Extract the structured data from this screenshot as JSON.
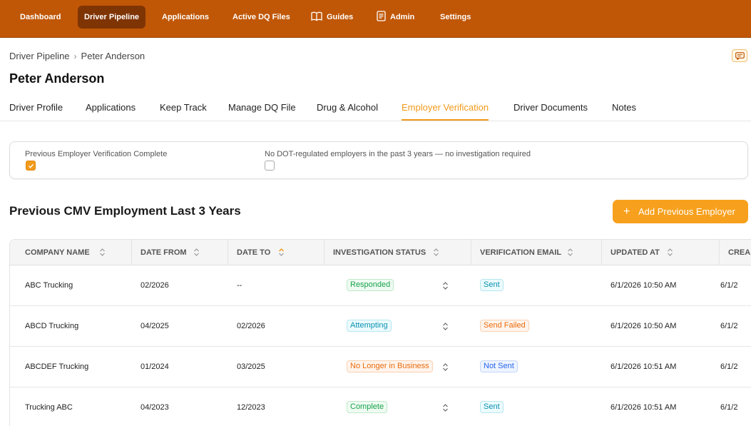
{
  "nav": {
    "items": [
      "Dashboard",
      "Driver Pipeline",
      "Applications",
      "Active DQ Files",
      "Guides",
      "Admin",
      "Settings"
    ],
    "active": "Driver Pipeline"
  },
  "breadcrumb": {
    "parent": "Driver Pipeline",
    "separator": "›",
    "current": "Peter Anderson"
  },
  "page": {
    "title": "Peter Anderson"
  },
  "tabs": {
    "items": [
      "Driver Profile",
      "Applications",
      "Keep Track",
      "Manage DQ File",
      "Drug & Alcohol",
      "Employer Verification",
      "Driver Documents",
      "Notes"
    ],
    "active": "Employer Verification"
  },
  "verification": {
    "complete_label": "Previous Employer Verification Complete",
    "complete_checked": true,
    "no_dot_label": "No DOT-regulated employers in the past 3 years — no investigation required",
    "no_dot_checked": false
  },
  "section": {
    "title": "Previous CMV Employment Last 3 Years",
    "add_button": "Add Previous Employer",
    "add_icon": "+"
  },
  "table": {
    "columns": [
      "COMPANY NAME",
      "DATE FROM",
      "DATE TO",
      "INVESTIGATION STATUS",
      "VERIFICATION EMAIL",
      "UPDATED AT",
      "CREA"
    ],
    "rows": [
      {
        "company": "ABC Trucking",
        "from": "02/2026",
        "to": "--",
        "status": "Responded",
        "email": "Sent",
        "updated": "6/1/2026 10:50 AM",
        "created": "6/1/2"
      },
      {
        "company": "ABCD Trucking",
        "from": "04/2025",
        "to": "02/2026",
        "status": "Attempting",
        "email": "Send Failed",
        "updated": "6/1/2026 10:50 AM",
        "created": "6/1/2"
      },
      {
        "company": "ABCDEF Trucking",
        "from": "01/2024",
        "to": "03/2025",
        "status": "No Longer in Business",
        "email": "Not Sent",
        "updated": "6/1/2026 10:51 AM",
        "created": "6/1/2"
      },
      {
        "company": "Trucking ABC",
        "from": "04/2023",
        "to": "12/2023",
        "status": "Complete",
        "email": "Sent",
        "updated": "6/1/2026 10:51 AM",
        "created": "6/1/2"
      }
    ]
  },
  "colors": {
    "nav_bg": "#c05706",
    "nav_active": "#7f3404",
    "accent": "#f29a1a",
    "button": "#f7a01d",
    "status_green": "#16a34a",
    "status_teal": "#0891b2",
    "status_orange": "#ea6a0c",
    "status_blue": "#2563eb"
  },
  "icons": {
    "guides": "book-icon",
    "admin": "document-icon",
    "messages": "chat-icon",
    "sort": "sort-icon"
  }
}
